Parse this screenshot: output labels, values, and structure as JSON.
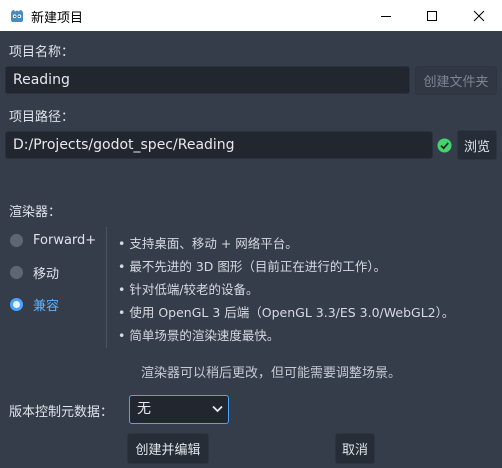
{
  "window": {
    "title": "新建项目"
  },
  "project_name": {
    "label": "项目名称：",
    "value": "Reading",
    "create_folder_button": "创建文件夹"
  },
  "project_path": {
    "label": "项目路径：",
    "value": "D:/Projects/godot_spec/Reading",
    "browse_button": "浏览"
  },
  "renderer": {
    "label": "渲染器：",
    "options": [
      {
        "label": "Forward+",
        "selected": false
      },
      {
        "label": "移动",
        "selected": false
      },
      {
        "label": "兼容",
        "selected": true
      }
    ],
    "description": [
      "• 支持桌面、移动 + 网络平台。",
      "• 最不先进的 3D 图形（目前正在进行的工作）。",
      "• 针对低端/较老的设备。",
      "• 使用 OpenGL 3 后端（OpenGL 3.3/ES 3.0/WebGL2）。",
      "• 简单场景的渲染速度最快。"
    ],
    "note": "渲染器可以稍后更改，但可能需要调整场景。"
  },
  "vcs": {
    "label": "版本控制元数据：",
    "selected": "无"
  },
  "footer": {
    "create_edit_button": "创建并编辑",
    "cancel_button": "取消"
  },
  "colors": {
    "background": "#363d4a",
    "field_bg": "#22272f",
    "accent": "#4aa3ff",
    "valid": "#45d36b"
  },
  "icons": {
    "app": "godot-icon",
    "valid": "check-circle-icon",
    "dropdown": "chevron-down-icon"
  }
}
